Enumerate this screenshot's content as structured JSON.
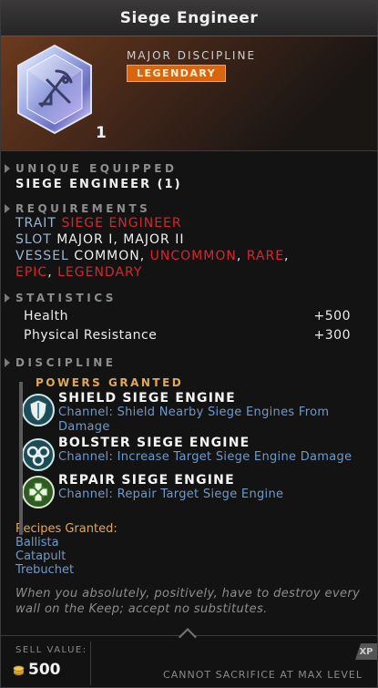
{
  "item": {
    "name": "Siege Engineer",
    "type": "MAJOR DISCIPLINE",
    "rarity": "LEGENDARY",
    "count": "1"
  },
  "unique": {
    "header": "UNIQUE EQUIPPED",
    "value": "SIEGE ENGINEER (1)"
  },
  "requirements": {
    "header": "REQUIREMENTS",
    "trait_key": "TRAIT",
    "trait_value": "SIEGE ENGINEER",
    "slot_key": "SLOT",
    "slot_value": "MAJOR I, MAJOR II",
    "vessel_key": "VESSEL",
    "vessel_common": "COMMON,",
    "vessel_uncommon": "UNCOMMON",
    "vessel_rare": "RARE",
    "vessel_epic": "EPIC",
    "vessel_legendary": "LEGENDARY",
    "comma": ","
  },
  "statistics": {
    "header": "STATISTICS",
    "rows": [
      {
        "label": "Health",
        "value": "+500"
      },
      {
        "label": "Physical Resistance",
        "value": "+300"
      }
    ]
  },
  "discipline": {
    "header": "DISCIPLINE",
    "powers_header": "POWERS GRANTED",
    "powers": [
      {
        "title": "SHIELD SIEGE ENGINE",
        "desc": "Channel: Shield Nearby Siege Engines From Damage",
        "icon": "shield-icon"
      },
      {
        "title": "BOLSTER SIEGE ENGINE",
        "desc": "Channel: Increase Target Siege Engine Damage",
        "icon": "bolster-swirl-icon"
      },
      {
        "title": "REPAIR SIEGE ENGINE",
        "desc": "Channel: Repair Target Siege Engine",
        "icon": "repair-cross-icon"
      }
    ]
  },
  "recipes": {
    "header": "Recipes Granted:",
    "items": [
      "Ballista",
      "Catapult",
      "Trebuchet"
    ]
  },
  "flavor": "When you absolutely, positively, have to destroy every wall on the Keep; accept no substitutes.",
  "footer": {
    "sell_label": "SELL VALUE:",
    "sell_value": "500",
    "xp": "XP",
    "cannot_sacrifice": "CANNOT SACRIFICE AT MAX LEVEL"
  },
  "colors": {
    "legendary": "#d9650f",
    "red_text": "#d9262b",
    "blue_text": "#6e99c9",
    "gold_text": "#e3a856"
  }
}
